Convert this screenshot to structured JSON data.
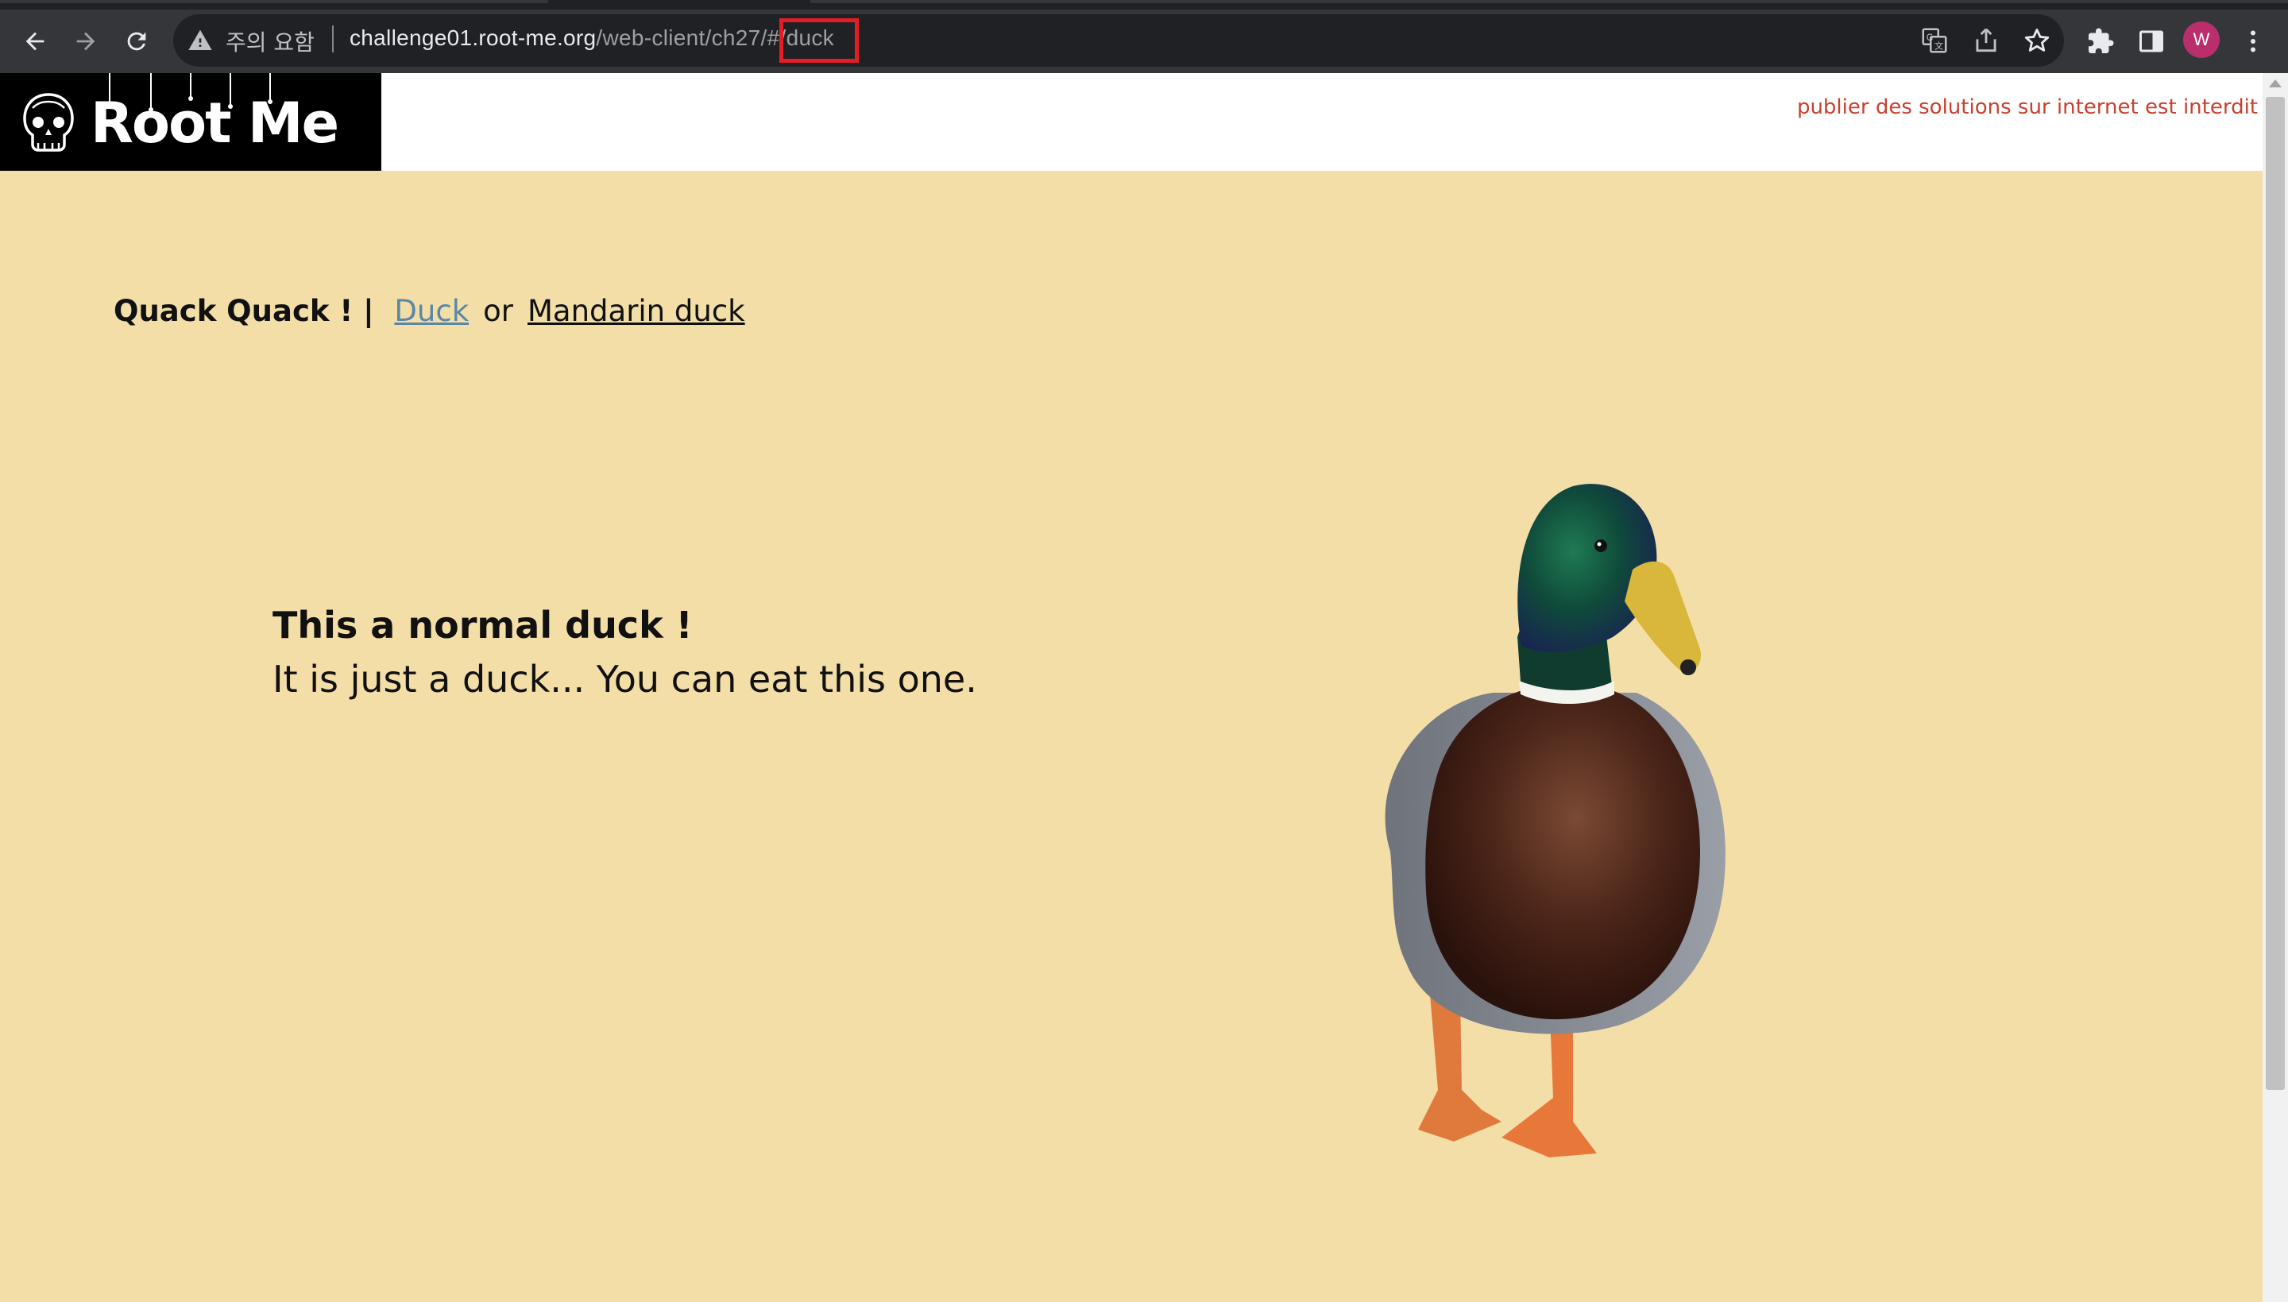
{
  "browser": {
    "security_label": "주의 요함",
    "url_host": "challenge01.root-me.org",
    "url_path": "/web-client/ch27/",
    "url_fragment": "#/duck",
    "avatar_letter": "W"
  },
  "header": {
    "logo_text": "Root Me",
    "disclaimer": "publier des solutions sur internet est interdit"
  },
  "nav": {
    "brand": "Quack Quack ! |",
    "link_duck": "Duck",
    "or_text": "or",
    "link_mandarin": "Mandarin duck"
  },
  "content": {
    "title": "This a normal duck !",
    "description": "It is just a duck... You can eat this one."
  },
  "colors": {
    "page_background": "#f3dea8",
    "disclaimer": "#c8412f",
    "active_link": "#5b87a6",
    "url_highlight": "#e51e25"
  }
}
